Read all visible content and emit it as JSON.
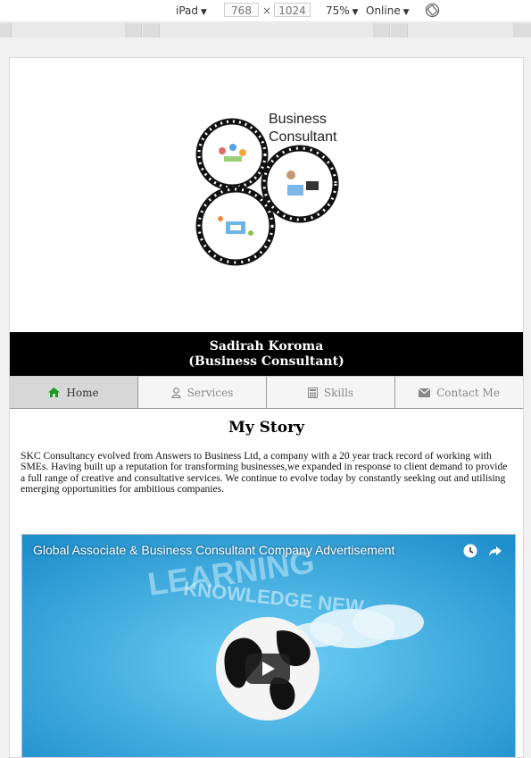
{
  "devtools": {
    "device": "iPad",
    "width": "768",
    "times": "×",
    "height": "1024",
    "zoom": "75%",
    "network": "Online"
  },
  "logo": {
    "line1": "Business",
    "line2": "Consultant"
  },
  "banner": {
    "name": "Sadirah Koroma",
    "role": "(Business Consultant)"
  },
  "nav": [
    {
      "label": "Home",
      "icon": "home-icon"
    },
    {
      "label": "Services",
      "icon": "user-icon"
    },
    {
      "label": "Skills",
      "icon": "calculator-icon"
    },
    {
      "label": "Contact Me",
      "icon": "envelope-icon"
    }
  ],
  "story": {
    "title": "My Story",
    "text": "SKC Consultancy evolved from Answers to Business Ltd, a company with a 20 year track record of working with SMEs. Having built up a reputation for transforming businesses,we expanded in response to client demand to provide a full range of creative and consultative services. We continue to evolve today by constantly seeking out and utilising emerging opportunities for ambitious companies."
  },
  "video": {
    "title": "Global Associate & Business Consultant Company Advertisement",
    "bg_word1": "LEARNING",
    "bg_word2": "KNOWLEDGE NEW"
  },
  "colors": {
    "banner_bg": "#000000",
    "nav_active": "#d7d7d7",
    "home_icon": "#1a9a1a",
    "video_bg": "#2fa7df"
  }
}
